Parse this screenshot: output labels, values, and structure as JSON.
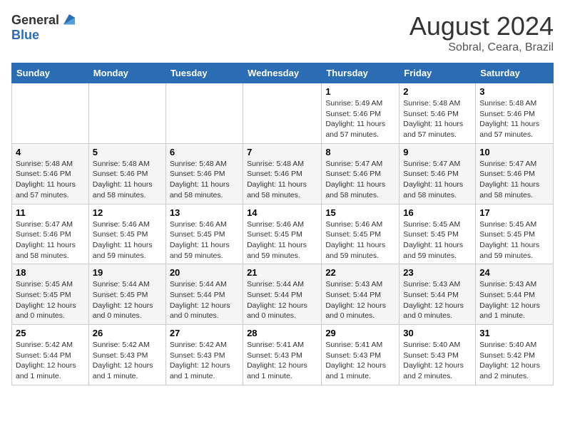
{
  "logo": {
    "general": "General",
    "blue": "Blue"
  },
  "title": "August 2024",
  "subtitle": "Sobral, Ceara, Brazil",
  "days_of_week": [
    "Sunday",
    "Monday",
    "Tuesday",
    "Wednesday",
    "Thursday",
    "Friday",
    "Saturday"
  ],
  "weeks": [
    [
      {
        "day": "",
        "info": ""
      },
      {
        "day": "",
        "info": ""
      },
      {
        "day": "",
        "info": ""
      },
      {
        "day": "",
        "info": ""
      },
      {
        "day": "1",
        "info": "Sunrise: 5:49 AM\nSunset: 5:46 PM\nDaylight: 11 hours and 57 minutes."
      },
      {
        "day": "2",
        "info": "Sunrise: 5:48 AM\nSunset: 5:46 PM\nDaylight: 11 hours and 57 minutes."
      },
      {
        "day": "3",
        "info": "Sunrise: 5:48 AM\nSunset: 5:46 PM\nDaylight: 11 hours and 57 minutes."
      }
    ],
    [
      {
        "day": "4",
        "info": "Sunrise: 5:48 AM\nSunset: 5:46 PM\nDaylight: 11 hours and 57 minutes."
      },
      {
        "day": "5",
        "info": "Sunrise: 5:48 AM\nSunset: 5:46 PM\nDaylight: 11 hours and 58 minutes."
      },
      {
        "day": "6",
        "info": "Sunrise: 5:48 AM\nSunset: 5:46 PM\nDaylight: 11 hours and 58 minutes."
      },
      {
        "day": "7",
        "info": "Sunrise: 5:48 AM\nSunset: 5:46 PM\nDaylight: 11 hours and 58 minutes."
      },
      {
        "day": "8",
        "info": "Sunrise: 5:47 AM\nSunset: 5:46 PM\nDaylight: 11 hours and 58 minutes."
      },
      {
        "day": "9",
        "info": "Sunrise: 5:47 AM\nSunset: 5:46 PM\nDaylight: 11 hours and 58 minutes."
      },
      {
        "day": "10",
        "info": "Sunrise: 5:47 AM\nSunset: 5:46 PM\nDaylight: 11 hours and 58 minutes."
      }
    ],
    [
      {
        "day": "11",
        "info": "Sunrise: 5:47 AM\nSunset: 5:46 PM\nDaylight: 11 hours and 58 minutes."
      },
      {
        "day": "12",
        "info": "Sunrise: 5:46 AM\nSunset: 5:45 PM\nDaylight: 11 hours and 59 minutes."
      },
      {
        "day": "13",
        "info": "Sunrise: 5:46 AM\nSunset: 5:45 PM\nDaylight: 11 hours and 59 minutes."
      },
      {
        "day": "14",
        "info": "Sunrise: 5:46 AM\nSunset: 5:45 PM\nDaylight: 11 hours and 59 minutes."
      },
      {
        "day": "15",
        "info": "Sunrise: 5:46 AM\nSunset: 5:45 PM\nDaylight: 11 hours and 59 minutes."
      },
      {
        "day": "16",
        "info": "Sunrise: 5:45 AM\nSunset: 5:45 PM\nDaylight: 11 hours and 59 minutes."
      },
      {
        "day": "17",
        "info": "Sunrise: 5:45 AM\nSunset: 5:45 PM\nDaylight: 11 hours and 59 minutes."
      }
    ],
    [
      {
        "day": "18",
        "info": "Sunrise: 5:45 AM\nSunset: 5:45 PM\nDaylight: 12 hours and 0 minutes."
      },
      {
        "day": "19",
        "info": "Sunrise: 5:44 AM\nSunset: 5:45 PM\nDaylight: 12 hours and 0 minutes."
      },
      {
        "day": "20",
        "info": "Sunrise: 5:44 AM\nSunset: 5:44 PM\nDaylight: 12 hours and 0 minutes."
      },
      {
        "day": "21",
        "info": "Sunrise: 5:44 AM\nSunset: 5:44 PM\nDaylight: 12 hours and 0 minutes."
      },
      {
        "day": "22",
        "info": "Sunrise: 5:43 AM\nSunset: 5:44 PM\nDaylight: 12 hours and 0 minutes."
      },
      {
        "day": "23",
        "info": "Sunrise: 5:43 AM\nSunset: 5:44 PM\nDaylight: 12 hours and 0 minutes."
      },
      {
        "day": "24",
        "info": "Sunrise: 5:43 AM\nSunset: 5:44 PM\nDaylight: 12 hours and 1 minute."
      }
    ],
    [
      {
        "day": "25",
        "info": "Sunrise: 5:42 AM\nSunset: 5:44 PM\nDaylight: 12 hours and 1 minute."
      },
      {
        "day": "26",
        "info": "Sunrise: 5:42 AM\nSunset: 5:43 PM\nDaylight: 12 hours and 1 minute."
      },
      {
        "day": "27",
        "info": "Sunrise: 5:42 AM\nSunset: 5:43 PM\nDaylight: 12 hours and 1 minute."
      },
      {
        "day": "28",
        "info": "Sunrise: 5:41 AM\nSunset: 5:43 PM\nDaylight: 12 hours and 1 minute."
      },
      {
        "day": "29",
        "info": "Sunrise: 5:41 AM\nSunset: 5:43 PM\nDaylight: 12 hours and 1 minute."
      },
      {
        "day": "30",
        "info": "Sunrise: 5:40 AM\nSunset: 5:43 PM\nDaylight: 12 hours and 2 minutes."
      },
      {
        "day": "31",
        "info": "Sunrise: 5:40 AM\nSunset: 5:42 PM\nDaylight: 12 hours and 2 minutes."
      }
    ]
  ]
}
